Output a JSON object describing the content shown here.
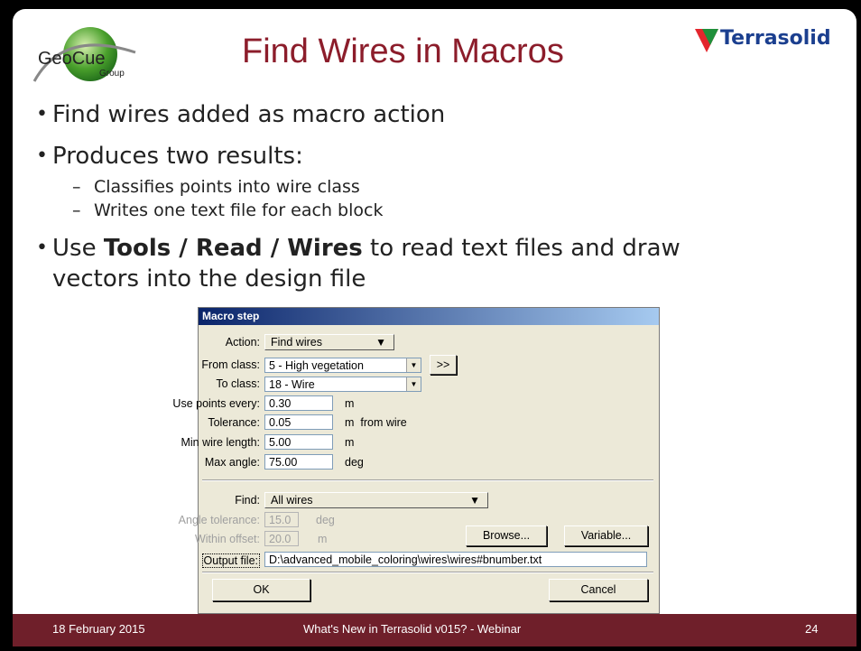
{
  "slide": {
    "title": "Find Wires in Macros",
    "logo_left": {
      "main": "GeoCue",
      "sub": "Group"
    },
    "logo_right": {
      "text": "Terrasolid"
    },
    "bullets": [
      {
        "text": "Find wires added as macro action"
      },
      {
        "text": "Produces two results:"
      },
      {
        "text": "Classifies points into wire class"
      },
      {
        "text": "Writes one text file for each block"
      },
      {
        "pre": "Use ",
        "bold": "Tools / Read / Wires",
        "post": " to read text files and draw"
      },
      {
        "text": "vectors into the design file"
      }
    ],
    "footer": {
      "date": "18 February 2015",
      "center": "What's New in Terrasolid v015? - Webinar",
      "page": "24"
    }
  },
  "dialog": {
    "title": "Macro step",
    "action": {
      "label": "Action:",
      "value": "Find wires"
    },
    "from_class": {
      "label": "From class:",
      "value": "5 - High vegetation",
      "more_button": ">>"
    },
    "to_class": {
      "label": "To class:",
      "value": "18 - Wire"
    },
    "use_points": {
      "label": "Use points every:",
      "value": "0.30",
      "unit": "m"
    },
    "tolerance": {
      "label": "Tolerance:",
      "value": "0.05",
      "unit": "m  from wire"
    },
    "min_wire_length": {
      "label": "Min wire length:",
      "value": "5.00",
      "unit": "m"
    },
    "max_angle": {
      "label": "Max angle:",
      "value": "75.00",
      "unit": "deg"
    },
    "find": {
      "label": "Find:",
      "value": "All wires"
    },
    "angle_tolerance": {
      "label": "Angle tolerance:",
      "value": "15.0",
      "unit": "deg"
    },
    "within_offset": {
      "label": "Within offset:",
      "value": "20.0",
      "unit": "m"
    },
    "browse_button": "Browse...",
    "variable_button": "Variable...",
    "output_file": {
      "label": "Output file:",
      "value": "D:\\advanced_mobile_coloring\\wires\\wires#bnumber.txt"
    },
    "ok_button": "OK",
    "cancel_button": "Cancel"
  }
}
